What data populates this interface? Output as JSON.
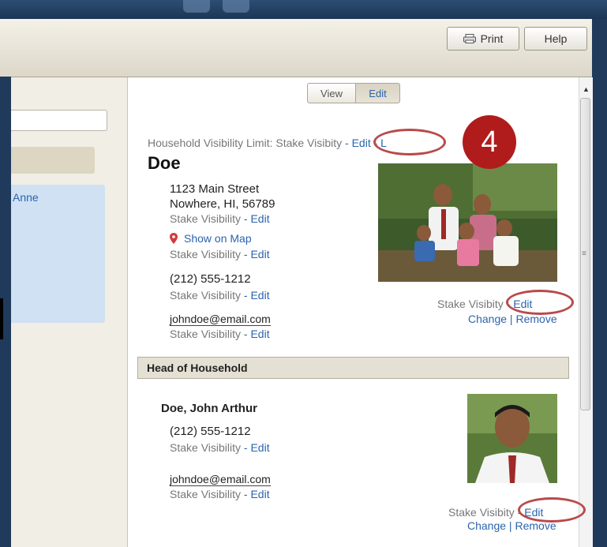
{
  "toolbar": {
    "print_label": "Print",
    "help_label": "Help"
  },
  "left": {
    "list_name": "Anne"
  },
  "tabs": {
    "view": "View",
    "edit": "Edit"
  },
  "household": {
    "visibility_label": "Household Visibility Limit: Stake Visibi",
    "visibility_edit": "- Edit",
    "visibility_sep": "- L",
    "family_name": "Doe",
    "address_line1": "1123 Main Street",
    "address_line2": "Nowhere, HI, 56789",
    "phone": "(212) 555-1212",
    "email": "johndoe@email.com",
    "show_on_map": "Show on Map"
  },
  "visibility": {
    "text": "Stake Visibility",
    "edit": "- Edit"
  },
  "photo_controls": {
    "vis_text_1": "Stake Visibi",
    "vis_tail_1": "ty",
    "edit": "- Edit",
    "change": "Change |",
    "remove_1": "Remove",
    "vis_text_2": "Stake Visibi",
    "vis_tail_2": "ty",
    "remove_2": "Remove"
  },
  "head_of_household": {
    "section_label": "Head of Household",
    "name": "Doe, John Arthur",
    "phone": "(212) 555-1212",
    "email": "johndoe@email.com"
  },
  "callout": {
    "number": "4"
  },
  "colors": {
    "link": "#2b64ad",
    "callout": "#b01c1c",
    "highlight_oval": "#b84a4a",
    "selection": "#cfe1f3"
  }
}
